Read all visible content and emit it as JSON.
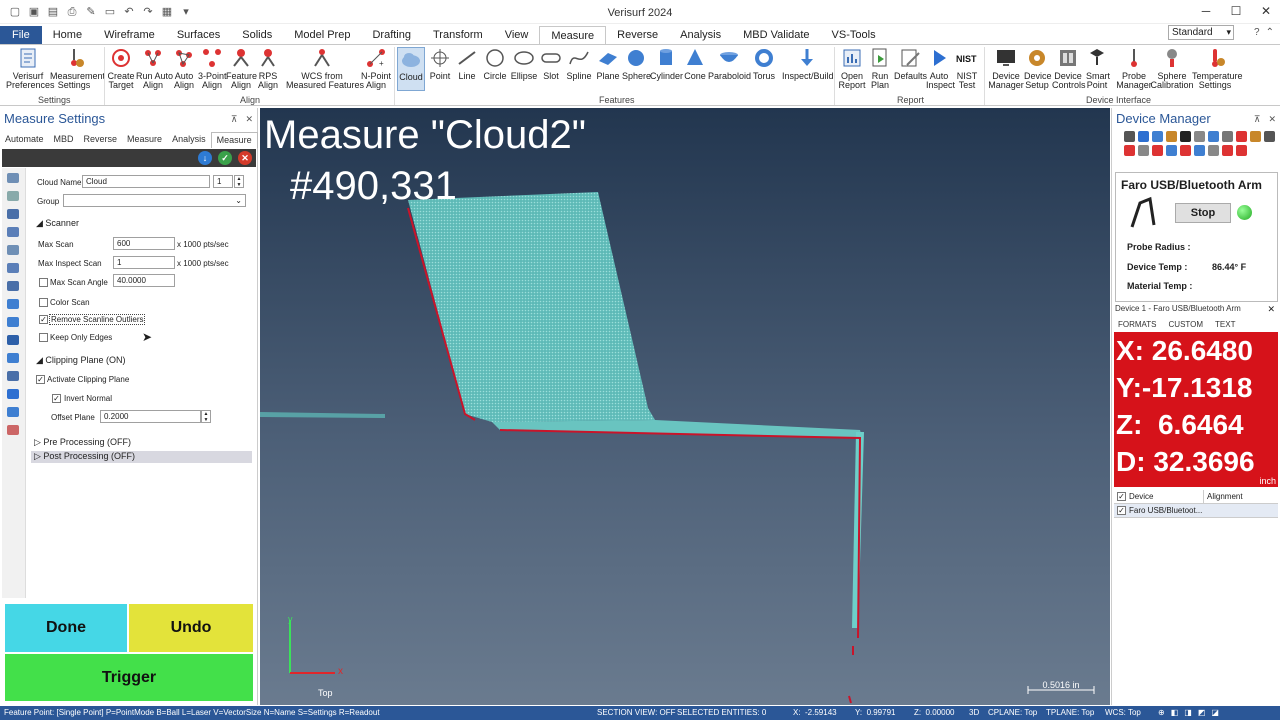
{
  "app": {
    "title": "Verisurf 2024"
  },
  "quick_access": [
    "new-icon",
    "save-icon",
    "save-all-icon",
    "print-icon",
    "edit-icon",
    "folder-icon",
    "undo-icon",
    "redo-icon",
    "settings-icon"
  ],
  "window": {
    "minimize": "─",
    "maximize": "☐",
    "close": "✕"
  },
  "tabs": [
    "File",
    "Home",
    "Wireframe",
    "Surfaces",
    "Solids",
    "Model Prep",
    "Drafting",
    "Transform",
    "View",
    "Measure",
    "Reverse",
    "Analysis",
    "MBD Validate",
    "VS-Tools"
  ],
  "active_tab": "Measure",
  "standard_select": "Standard",
  "ribbon": {
    "settings": {
      "group": "Settings",
      "items": [
        "Verisurf\nPreferences",
        "Measurement\nSettings"
      ]
    },
    "align": {
      "group": "Align",
      "items": [
        "Create\nTarget",
        "Run Auto\nAlign",
        "Auto\nAlign",
        "3-Point\nAlign",
        "Feature\nAlign",
        "RPS\nAlign",
        "WCS from\nMeasured Features",
        "N-Point\nAlign"
      ]
    },
    "features": {
      "group": "Features",
      "items": [
        "Cloud",
        "Point",
        "Line",
        "Circle",
        "Ellipse",
        "Slot",
        "Spline",
        "Plane",
        "Sphere",
        "Cylinder",
        "Cone",
        "Paraboloid",
        "Torus",
        "Inspect/Build"
      ]
    },
    "report": {
      "group": "Report",
      "items": [
        "Open\nReport",
        "Run\nPlan",
        "Defaults",
        "Auto\nInspect",
        "NIST\nTest"
      ]
    },
    "device": {
      "group": "Device Interface",
      "items": [
        "Device\nManager",
        "Device\nSetup",
        "Device\nControls",
        "Smart\nPoint",
        "Probe\nManager",
        "Sphere\nCalibration",
        "Temperature\nSettings"
      ]
    }
  },
  "left_panel": {
    "title": "Measure Settings",
    "pin": "⊼",
    "close": "✕",
    "subtabs": [
      "Automate",
      "MBD",
      "Reverse",
      "Measure",
      "Analysis",
      "Measure Settings"
    ],
    "cloud_name_label": "Cloud Name",
    "cloud_name": "Cloud",
    "cloud_index": "1",
    "group_label": "Group",
    "scanner_section": "Scanner",
    "max_scan_label": "Max Scan",
    "max_scan": "600",
    "unit": "x 1000 pts/sec",
    "max_inspect_label": "Max Inspect Scan",
    "max_inspect": "1",
    "max_angle_label": "Max Scan Angle",
    "max_angle": "40.0000",
    "color_scan": "Color Scan",
    "remove_outliers": "Remove Scanline Outliers",
    "keep_edges": "Keep Only Edges",
    "clipping_section": "Clipping Plane (ON)",
    "activate_clipping": "Activate Clipping Plane",
    "invert_normal": "Invert Normal",
    "offset_label": "Offset Plane",
    "offset": "0.2000",
    "pre_processing": "Pre Processing (OFF)",
    "post_processing": "Post Processing (OFF)",
    "done": "Done",
    "undo": "Undo",
    "trigger": "Trigger"
  },
  "viewport": {
    "title": "Measure \"Cloud2\"",
    "count": "#490,331",
    "axis_x": "x",
    "axis_y": "y",
    "view_name": "Top",
    "scale": "0.5016 in"
  },
  "device_panel": {
    "title": "Device Manager",
    "pin": "⊼",
    "close": "✕",
    "device_name": "Faro USB/Bluetooth Arm",
    "stop": "Stop",
    "probe_radius": "Probe Radius :",
    "device_temp_label": "Device Temp :",
    "device_temp": "86.44° F",
    "material_temp": "Material Temp :",
    "device_header": "Device 1 - Faro USB/Bluetooth Arm",
    "format_tabs": [
      "FORMATS",
      "CUSTOM",
      "TEXT"
    ],
    "readout": {
      "x": "X: 26.6480",
      "y": "Y:-17.1318",
      "z": "Z:  6.6464",
      "d": "D: 32.3696",
      "unit": "inch"
    },
    "table_headers": [
      "Device",
      "Alignment"
    ],
    "table_row": "Faro USB/Bluetoot..."
  },
  "status": {
    "hint": "Feature Point: [Single Point]  P=PointMode  B=Ball  L=Laser  V=VectorSize  N=Name  S=Settings  R=Readout",
    "section_view": "SECTION VIEW: OFF",
    "selected": "SELECTED ENTITIES: 0",
    "x": "X:  -2.59143",
    "y": "Y:  0.99791",
    "z": "Z:  0.00000",
    "mode": "3D",
    "cplane": "CPLANE: Top",
    "tplane": "TPLANE: Top",
    "wcs": "WCS: Top"
  },
  "colors": {
    "accent": "#2b5797",
    "done": "#45d7e6",
    "undo": "#e3e33a",
    "trigger": "#43e04a",
    "readout": "#d6121a",
    "cloud": "#63c9c5"
  }
}
